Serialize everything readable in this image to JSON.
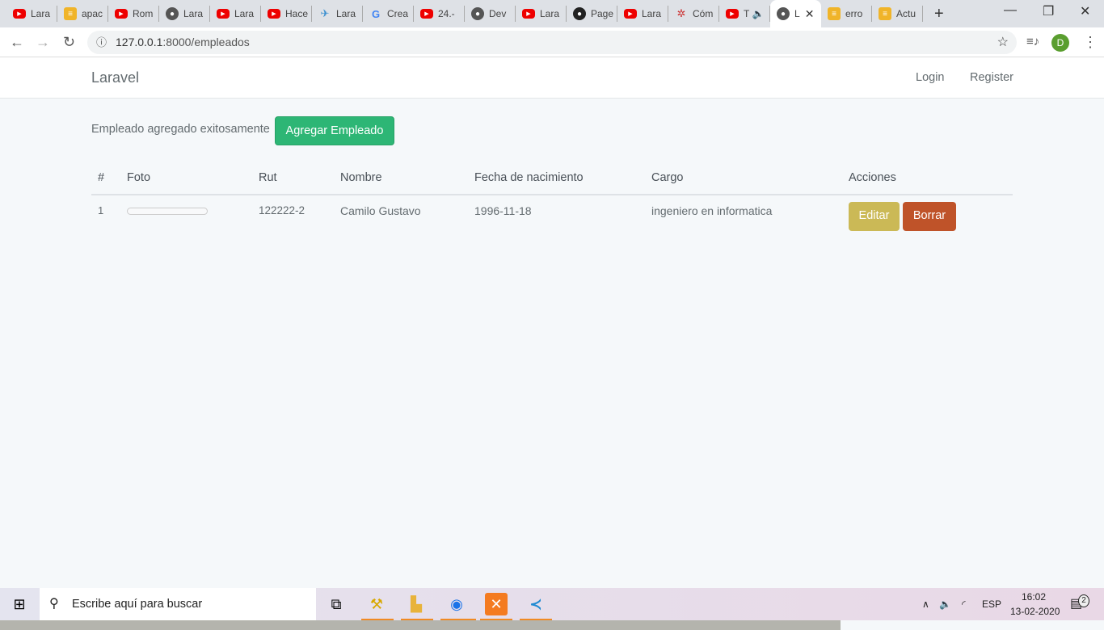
{
  "browser": {
    "tabs": [
      {
        "icon": "youtube",
        "label": "Lara"
      },
      {
        "icon": "stackoverflow",
        "label": "apac"
      },
      {
        "icon": "youtube",
        "label": "Rom"
      },
      {
        "icon": "globe",
        "label": "Lara"
      },
      {
        "icon": "youtube",
        "label": "Lara"
      },
      {
        "icon": "youtube",
        "label": "Hace"
      },
      {
        "icon": "send",
        "label": "Lara"
      },
      {
        "icon": "google",
        "label": "Crea"
      },
      {
        "icon": "youtube",
        "label": "24.-"
      },
      {
        "icon": "globe",
        "label": "Dev"
      },
      {
        "icon": "youtube",
        "label": "Lara"
      },
      {
        "icon": "github",
        "label": "Page"
      },
      {
        "icon": "youtube",
        "label": "Lara"
      },
      {
        "icon": "other",
        "label": "Cóm"
      },
      {
        "icon": "youtube",
        "label": "T 🔈"
      },
      {
        "icon": "globe",
        "label": "L",
        "active": true
      },
      {
        "icon": "stackoverflow",
        "label": "erro"
      },
      {
        "icon": "stackoverflow",
        "label": "Actu"
      }
    ],
    "url_host": "127.0.0.1",
    "url_rest": ":8000/empleados",
    "profile_initial": "D"
  },
  "navbar": {
    "brand": "Laravel",
    "login": "Login",
    "register": "Register"
  },
  "main": {
    "message": "Empleado agregado exitosamente",
    "add_button": "Agregar Empleado",
    "columns": [
      "#",
      "Foto",
      "Rut",
      "Nombre",
      "Fecha de nacimiento",
      "Cargo",
      "Acciones"
    ],
    "rows": [
      {
        "id": "1",
        "rut": "122222-2",
        "nombre": "Camilo Gustavo",
        "fecha": "1996-11-18",
        "cargo": "ingeniero en informatica",
        "edit": "Editar",
        "delete": "Borrar"
      }
    ]
  },
  "colors": {
    "add": "#2db675",
    "edit": "#cbb956",
    "delete": "#bf5329"
  },
  "taskbar": {
    "search_placeholder": "Escribe aquí para buscar",
    "lang": "ESP",
    "time": "16:02",
    "date": "13-02-2020",
    "notifications": "2"
  }
}
